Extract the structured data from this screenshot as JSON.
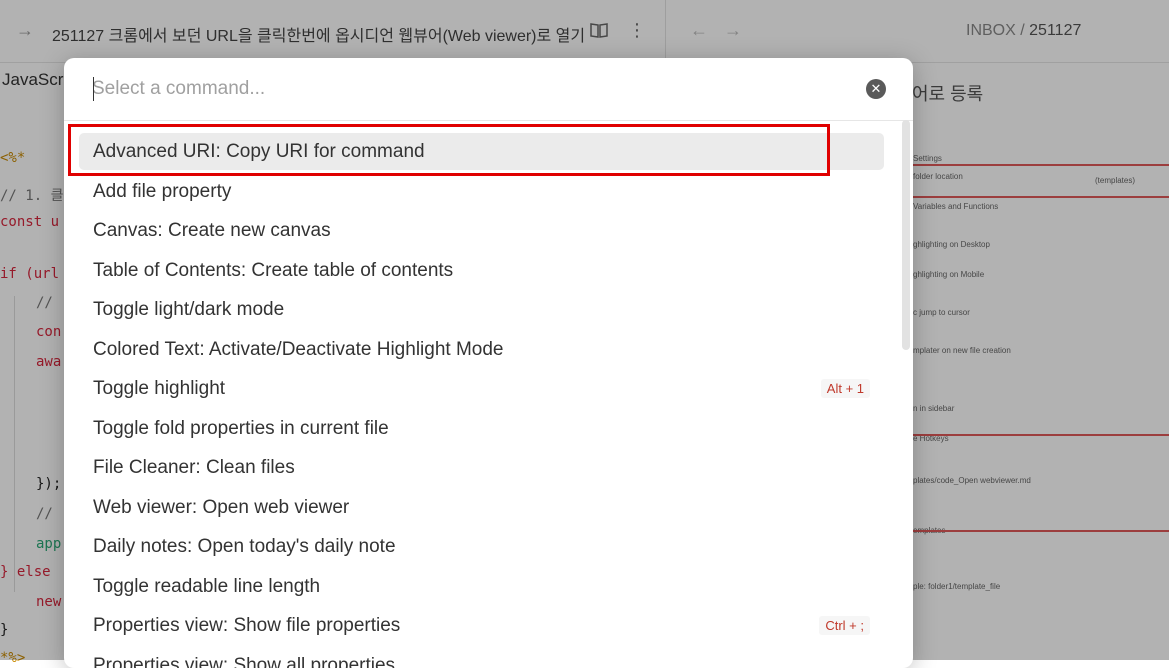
{
  "background": {
    "left_header": {
      "title": "251127 크롬에서 보던 URL을 클릭한번에 옵시디언 웹뷰어(Web viewer)로 열기",
      "tab_label": "JavaScri"
    },
    "code_lines": [
      {
        "text": "<%*",
        "kind": "tag"
      },
      {
        "text": "// 1. 클",
        "kind": "cm"
      },
      {
        "text": "const u",
        "kind": "kw"
      },
      {
        "text": "if (url",
        "kind": "kw"
      },
      {
        "text": "//",
        "kind": "cm"
      },
      {
        "text": "con",
        "kind": "kw"
      },
      {
        "text": "awa",
        "kind": "kw"
      },
      {
        "text": "});",
        "kind": "plain"
      },
      {
        "text": "//",
        "kind": "cm"
      },
      {
        "text": "app",
        "kind": "str"
      },
      {
        "text": "} else",
        "kind": "kw"
      },
      {
        "text": "new",
        "kind": "kw"
      },
      {
        "text": "}",
        "kind": "plain"
      },
      {
        "text": "*%>",
        "kind": "tag"
      }
    ],
    "right_header": {
      "breadcrumb_folder": "INBOX",
      "breadcrumb_sep": "/",
      "breadcrumb_file": "251127"
    },
    "right_note_text": "어로 등록",
    "settings_rows": [
      {
        "text": "Settings"
      },
      {
        "text": "folder location"
      },
      {
        "text": "(templates)"
      },
      {
        "text": "Variables and Functions"
      },
      {
        "text": "ghlighting on Desktop"
      },
      {
        "text": "ghlighting on Mobile"
      },
      {
        "text": "c jump to cursor"
      },
      {
        "text": "mplater on new file creation"
      },
      {
        "text": "n in sidebar"
      },
      {
        "text": "e Hotkeys"
      },
      {
        "text": "plates/code_Open webviewer.md"
      },
      {
        "text": "emplates"
      },
      {
        "text": "ple: folder1/template_file"
      }
    ]
  },
  "palette": {
    "search_placeholder": "Select a command...",
    "items": [
      {
        "label": "Advanced URI: Copy URI for command",
        "hotkey": ""
      },
      {
        "label": "Add file property",
        "hotkey": ""
      },
      {
        "label": "Canvas: Create new canvas",
        "hotkey": ""
      },
      {
        "label": "Table of Contents: Create table of contents",
        "hotkey": ""
      },
      {
        "label": "Toggle light/dark mode",
        "hotkey": ""
      },
      {
        "label": "Colored Text: Activate/Deactivate Highlight Mode",
        "hotkey": ""
      },
      {
        "label": "Toggle highlight",
        "hotkey": "Alt + 1"
      },
      {
        "label": "Toggle fold properties in current file",
        "hotkey": ""
      },
      {
        "label": "File Cleaner: Clean files",
        "hotkey": ""
      },
      {
        "label": "Web viewer: Open web viewer",
        "hotkey": ""
      },
      {
        "label": "Daily notes: Open today's daily note",
        "hotkey": ""
      },
      {
        "label": "Toggle readable line length",
        "hotkey": ""
      },
      {
        "label": "Properties view: Show file properties",
        "hotkey": "Ctrl + ;"
      },
      {
        "label": "Properties view: Show all properties",
        "hotkey": ""
      }
    ]
  },
  "colors": {
    "annotation_box": "#e00000",
    "hotkey_text": "#c0392b",
    "selected_row": "#ebebeb"
  }
}
